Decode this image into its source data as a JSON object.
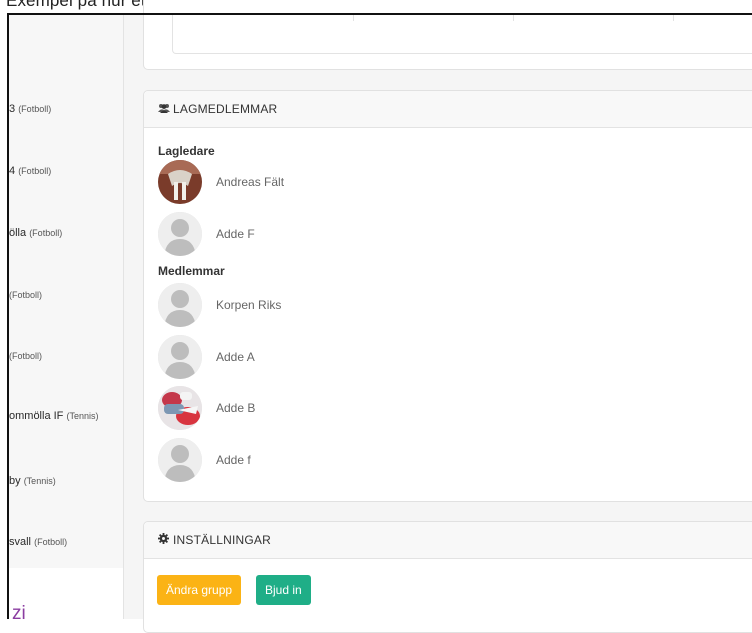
{
  "top_caption": "Exempel på hur ett lag med lagmedlemmar fångat ner på er lagsida.",
  "sidebar": {
    "items": [
      {
        "name": "3",
        "sport": "(Fotboll)"
      },
      {
        "name": "4",
        "sport": "(Fotboll)"
      },
      {
        "name": "ölla",
        "sport": "(Fotboll)"
      },
      {
        "name": "",
        "sport": "(Fotboll)"
      },
      {
        "name": "",
        "sport": "(Fotboll)"
      },
      {
        "name": "ommölla IF",
        "sport": "(Tennis)"
      },
      {
        "name": "by",
        "sport": "(Tennis)"
      },
      {
        "name": "svall",
        "sport": "(Fotboll)"
      }
    ],
    "bottom_text": "zi"
  },
  "members_panel": {
    "icon": "users-icon",
    "title": "LAGMEDLEMMAR",
    "leaders_label": "Lagledare",
    "leaders": [
      {
        "name": "Andreas Fält",
        "avatar": "photo"
      },
      {
        "name": "Adde F",
        "avatar": "placeholder"
      }
    ],
    "members_label": "Medlemmar",
    "members": [
      {
        "name": "Korpen Riks",
        "avatar": "placeholder"
      },
      {
        "name": "Adde A",
        "avatar": "placeholder"
      },
      {
        "name": "Adde B",
        "avatar": "photo"
      },
      {
        "name": "Adde f",
        "avatar": "placeholder"
      }
    ]
  },
  "settings_panel": {
    "icon": "gear-icon",
    "title": "INSTÄLLNINGAR",
    "edit_button": "Ändra grupp",
    "invite_button": "Bjud in"
  },
  "colors": {
    "edit_button": "#fbb315",
    "invite_button": "#1fae87",
    "bottom_text": "#8b3da1"
  }
}
